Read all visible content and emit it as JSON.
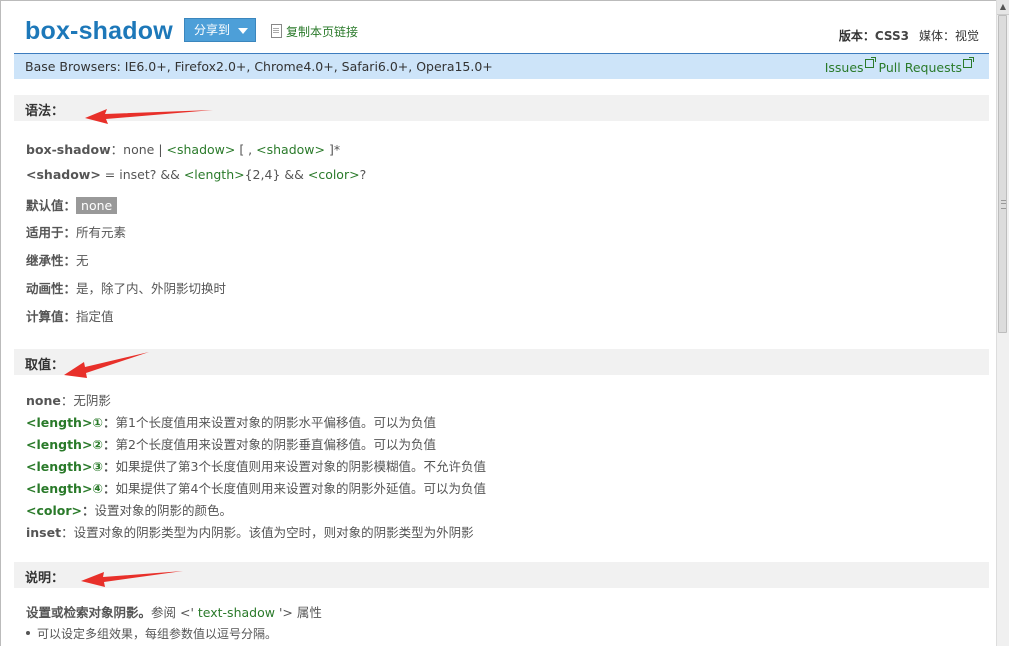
{
  "header": {
    "title": "box-shadow",
    "share_label": "分享到",
    "copy_link_label": "复制本页链接",
    "version_label": "版本：",
    "version_value": "CSS3",
    "media_label": "媒体：",
    "media_value": "视觉"
  },
  "browsers": {
    "text": "Base Browsers: IE6.0+, Firefox2.0+, Chrome4.0+, Safari6.0+, Opera15.0+",
    "issues_label": "Issues",
    "pull_requests_label": "Pull Requests"
  },
  "syntax": {
    "heading": "语法：",
    "line1": {
      "prop": "box-shadow",
      "sep": "：none | ",
      "t1": "<shadow>",
      "mid": " [ , ",
      "t2": "<shadow>",
      "end": " ]*"
    },
    "line2": {
      "prop": "<shadow>",
      "eq": " = inset? && ",
      "t1": "<length>",
      "range": "{2,4} && ",
      "t2": "<color>",
      "end": "?"
    },
    "default_label": "默认值：",
    "default_value": "none",
    "applies_label": "适用于：",
    "applies_value": "所有元素",
    "inherit_label": "继承性：",
    "inherit_value": "无",
    "animation_label": "动画性：",
    "animation_value": "是，除了内、外阴影切换时",
    "computed_label": "计算值：",
    "computed_value": "指定值"
  },
  "values": {
    "heading": "取值：",
    "items": [
      {
        "term": "none",
        "sep": "：",
        "desc": "无阴影"
      },
      {
        "term": "<length>①",
        "sep": "：",
        "desc": "第1个长度值用来设置对象的阴影水平偏移值。可以为负值"
      },
      {
        "term": "<length>②",
        "sep": "：",
        "desc": "第2个长度值用来设置对象的阴影垂直偏移值。可以为负值"
      },
      {
        "term": "<length>③",
        "sep": "：",
        "desc": "如果提供了第3个长度值则用来设置对象的阴影模糊值。不允许负值"
      },
      {
        "term": "<length>④",
        "sep": "：",
        "desc": "如果提供了第4个长度值则用来设置对象的阴影外延值。可以为负值"
      },
      {
        "term": "<color>",
        "sep": "：",
        "desc": "设置对象的阴影的颜色。"
      },
      {
        "term": "inset",
        "sep": "：",
        "desc": "设置对象的阴影类型为内阴影。该值为空时，则对象的阴影类型为外阴影"
      }
    ]
  },
  "description": {
    "heading": "说明：",
    "main_bold": "设置或检索对象阴影。",
    "see": "参阅 <' ",
    "see_link": "text-shadow",
    "see_end": " '> 属性",
    "bullets": [
      "可以设定多组效果，每组参数值以逗号分隔。"
    ]
  },
  "colors": {
    "title": "#1d78b9",
    "green": "#2a7a2a",
    "browser_bar": "#cde4f9",
    "arrow": "#e8302a"
  }
}
